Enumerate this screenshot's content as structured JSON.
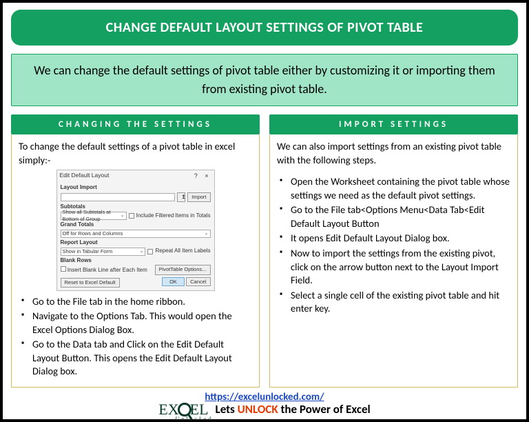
{
  "title": "CHANGE DEFAULT LAYOUT SETTINGS OF PIVOT TABLE",
  "intro": "We can change the default settings of pivot table either by customizing it or importing them from existing pivot table.",
  "left": {
    "header": "CHANGING THE SETTINGS",
    "lead": "To change the default settings of a pivot table in excel simply:-",
    "steps": [
      "Go to the File tab in the home ribbon.",
      "Navigate to the Options Tab. This would open the Excel Options Dialog Box.",
      "Go to the Data tab and Click on the Edit Default Layout Button. This opens the Edit Default Layout Dialog box."
    ]
  },
  "right": {
    "header": "IMPORT SETTINGS",
    "lead": "We can also import settings from an existing pivot table with the following steps.",
    "steps": [
      "Open the Worksheet containing the pivot table whose settings we need as the default pivot settings.",
      "Go to the File tab<Options Menu<Data Tab<Edit Default Layout Button",
      "It opens Edit Default Layout Dialog box.",
      "Now to import the settings from the existing pivot, click on the arrow button next to the Layout Import Field.",
      "Select a single cell of the existing pivot table and hit enter key."
    ]
  },
  "dialog": {
    "title": "Edit Default Layout",
    "layout_import_label": "Layout Import",
    "import_btn": "Import",
    "subtotals_label": "Subtotals",
    "subtotals_value": "Show all Subtotals at Bottom of Group",
    "include_filtered": "Include Filtered Items in Totals",
    "grand_totals_label": "Grand Totals",
    "grand_totals_value": "Off for Rows and Columns",
    "report_layout_label": "Report Layout",
    "report_layout_value": "Show in Tabular Form",
    "repeat_labels": "Repeat All Item Labels",
    "blank_rows_label": "Blank Rows",
    "blank_rows_check": "Insert Blank Line after Each Item",
    "pivot_options_btn": "PivotTable Options...",
    "reset_btn": "Reset to Excel Default",
    "ok": "OK",
    "cancel": "Cancel"
  },
  "footer": {
    "url": "https://excelunlocked.com/",
    "logo_main1": "EX",
    "logo_main2": "EL",
    "logo_sub": "Unlocked",
    "tagline_pre": "Lets ",
    "tagline_highlight": "UNLOCK",
    "tagline_post": " the Power of Excel"
  }
}
